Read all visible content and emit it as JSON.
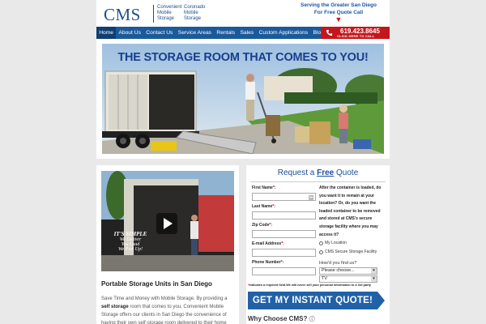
{
  "header": {
    "logo": "CMS",
    "logo_sub1": [
      "Convenient",
      "Mobile",
      "Storage"
    ],
    "logo_sub2": [
      "Coronado",
      "Mobile",
      "Storage"
    ],
    "serving_line1": "Serving the Greater San Diego",
    "serving_line2": "For Free Quote Call"
  },
  "nav": {
    "items": [
      "Home",
      "About Us",
      "Contact Us",
      "Service Areas",
      "Rentals",
      "Sales",
      "Custom Applications",
      "Blog"
    ],
    "phone": "619.423.8645",
    "phone_cta": "CLICK HERE TO CALL"
  },
  "hero": {
    "title": "THE STORAGE ROOM THAT COMES TO YOU!"
  },
  "video": {
    "line1": "IT'S SIMPLE",
    "line2": "We Deliver",
    "line3": "You Load",
    "line4": "We Pick Up!"
  },
  "content": {
    "heading": "Portable Storage Units in San Diego",
    "para_a": "Save Time and Money with Mobile Storage. By providing a ",
    "para_b": "self storage",
    "para_c": " room that comes to you, Convenient Mobile Storage offers our clients in San Diego the convenience of having their own self-storage room delivered to their home"
  },
  "quote_form": {
    "title_a": "Request a ",
    "title_b": "Free",
    "title_c": " Quote",
    "first_name": "First Name",
    "last_name": "Last Name",
    "zip": "Zip Code",
    "email": "E-mail Address",
    "phone": "Phone Number",
    "question": "After the container is loaded, do you want it to remain at your location? Or, do you want the loaded container to be removed and stored at CMS's secure storage facility where you may access it?",
    "option1": "My Location",
    "option2": "CMS Secure Storage Facility",
    "how_find": "How'd you find us?",
    "select1": "Please choose...",
    "select2": "TV",
    "note_a": "*",
    "note_b": "Indicates a required field.We will never sell your personal information to a 3rd party",
    "submit": "GET MY INSTANT QUOTE!",
    "why": "Why Choose CMS?"
  },
  "colors": {
    "brand_blue": "#1b5a9a",
    "phone_red": "#c4161c",
    "cta_blue": "#2161a8"
  }
}
